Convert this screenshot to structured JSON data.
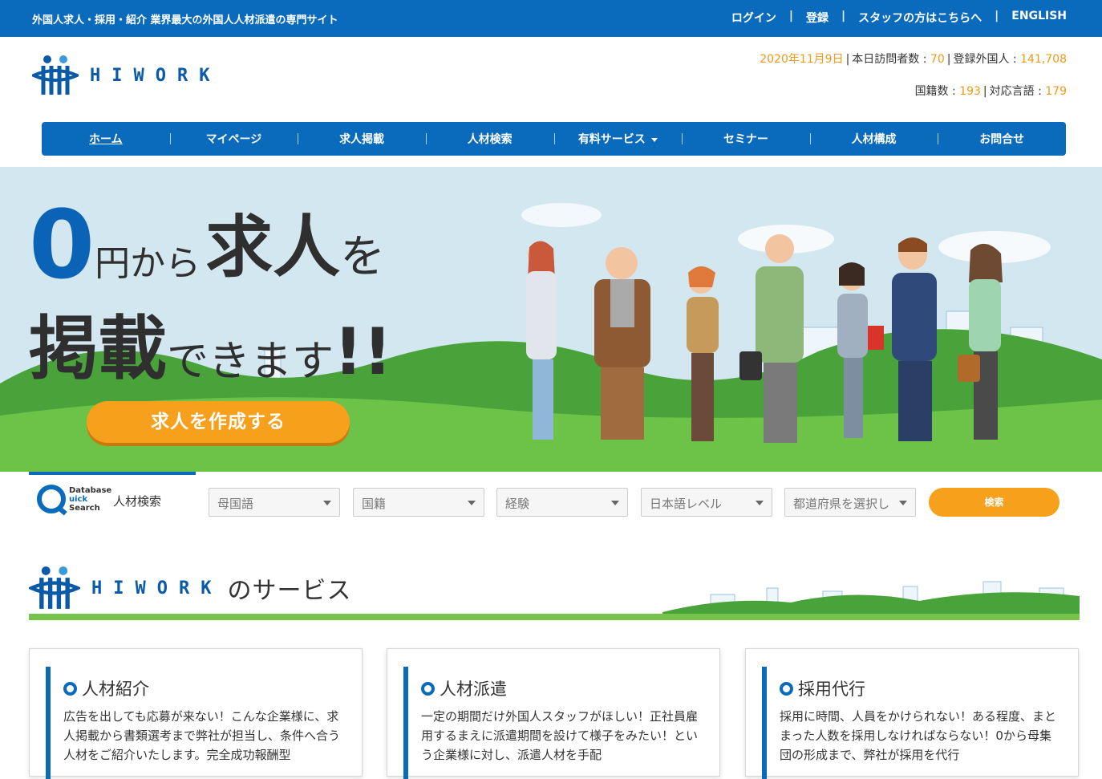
{
  "topbar": {
    "tagline": "外国人求人・採用・紹介 業界最大の外国人人材派遣の専門サイト",
    "links": [
      "ログイン",
      "登録",
      "スタッフの方はこちらへ",
      "ENGLISH"
    ]
  },
  "brand": {
    "name": "HIWORK",
    "logo_icon": "hiwork-logo-icon"
  },
  "stats": {
    "date": "2020年11月9日",
    "visitors_label": "本日訪問者数 : ",
    "visitors": "70",
    "registered_label": "登録外国人 : ",
    "registered": "141,708",
    "nationalities_label": "国籍数 : ",
    "nationalities": "193",
    "languages_label": "対応言語 : ",
    "languages": "179"
  },
  "nav": [
    "ホーム",
    "マイページ",
    "求人掲載",
    "人材検索",
    "有料サービス",
    "セミナー",
    "人材構成",
    "お問合せ"
  ],
  "hero": {
    "zero": "0",
    "yen_kara": "円から",
    "kyujin": "求人",
    "wo": "を",
    "keisai": "掲載",
    "dekimasu": "できます",
    "exclaim": "!!",
    "cta": "求人を作成する"
  },
  "quick_search": {
    "logo_line1": "Database",
    "logo_line2": "uick",
    "logo_line3": "Search",
    "label": "人材検索",
    "selects": [
      "母国語",
      "国籍",
      "経験",
      "日本語レベル",
      "都道府県を選択し"
    ],
    "button": "検索"
  },
  "services": {
    "heading_suffix": "のサービス",
    "cards": [
      {
        "title": "人材紹介",
        "text": "広告を出しても応募が来ない！こんな企業様に、求人掲載から書類選考まで弊社が担当し、条件へ合う人材をご紹介いたします。完全成功報酬型"
      },
      {
        "title": "人材派遣",
        "text": "一定の期間だけ外国人スタッフがほしい！正社員雇用するまえに派遣期間を設けて様子をみたい！という企業様に対し、派遣人材を手配"
      },
      {
        "title": "採用代行",
        "text": "採用に時間、人員をかけられない！ある程度、まとまった人数を採用しなければならない！0から母集団の形成まで、弊社が採用を代行"
      }
    ]
  }
}
